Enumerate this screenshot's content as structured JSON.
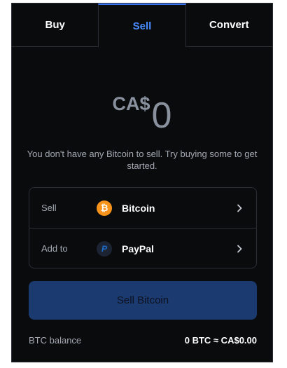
{
  "tabs": [
    {
      "label": "Buy",
      "active": false
    },
    {
      "label": "Sell",
      "active": true
    },
    {
      "label": "Convert",
      "active": false
    }
  ],
  "amount": {
    "currency": "CA$",
    "value": "0"
  },
  "message": "You don't have any Bitcoin to sell. Try buying some to get started.",
  "selector": {
    "sell_row": {
      "label": "Sell",
      "asset": "Bitcoin",
      "icon": "bitcoin-icon",
      "icon_glyph": "₿"
    },
    "addto_row": {
      "label": "Add to",
      "asset": "PayPal",
      "icon": "paypal-icon",
      "icon_glyph": "P"
    }
  },
  "sell_button": {
    "label": "Sell Bitcoin"
  },
  "balance": {
    "label": "BTC balance",
    "value": "0 BTC ≈ CA$0.00"
  },
  "colors": {
    "background": "#0a0b0d",
    "accent": "#3773f5",
    "button": "#1b3a6f",
    "bitcoin": "#f7931a"
  }
}
